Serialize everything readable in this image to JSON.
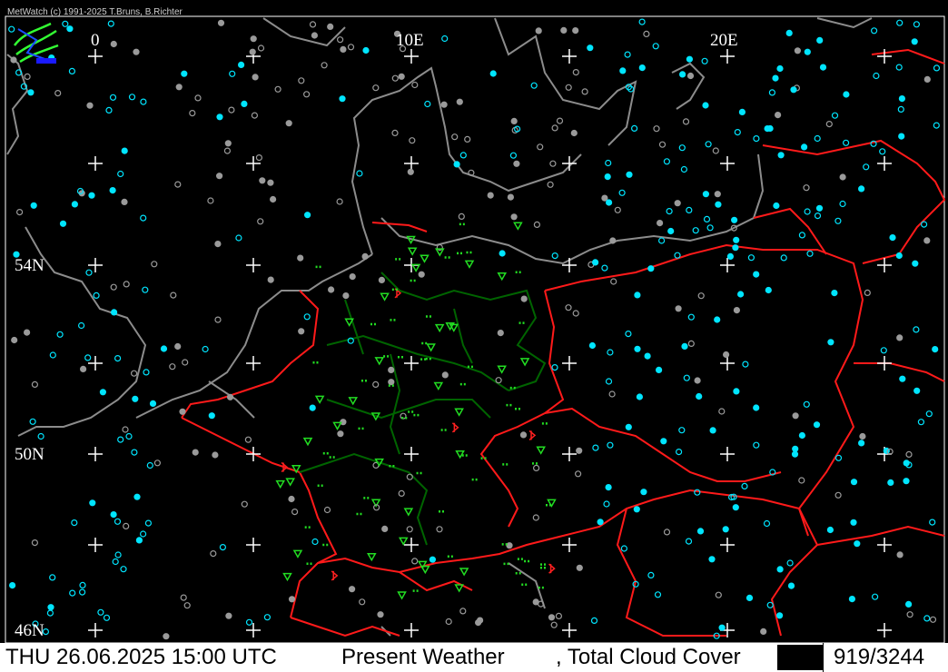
{
  "app": {
    "copyright": "MetWatch  (c) 1991-2025 T.Bruns, B.Richter"
  },
  "map": {
    "lon_labels": [
      "0",
      "10E",
      "20E"
    ],
    "lat_labels": [
      "54N",
      "50N",
      "46N"
    ],
    "colors": {
      "background": "#000000",
      "coastline": "#8c8c8c",
      "country_border": "#ff1a1a",
      "state_border": "#006400",
      "grid_cross": "#ffffff",
      "weather_symbol": "#22dd22",
      "significant_weather": "#ff2020",
      "cloud_station_a": "#00e5ff",
      "cloud_station_b": "#9a9a9a"
    },
    "icons": [
      "metwatch-logo-icon",
      "grid-cross-icon",
      "station-cloud-icon",
      "present-weather-icon"
    ]
  },
  "status": {
    "datetime": "THU 26.06.2025 15:00 UTC",
    "parameter1": "Present Weather",
    "parameter2": ", Total Cloud Cover",
    "count": "919/3244"
  }
}
